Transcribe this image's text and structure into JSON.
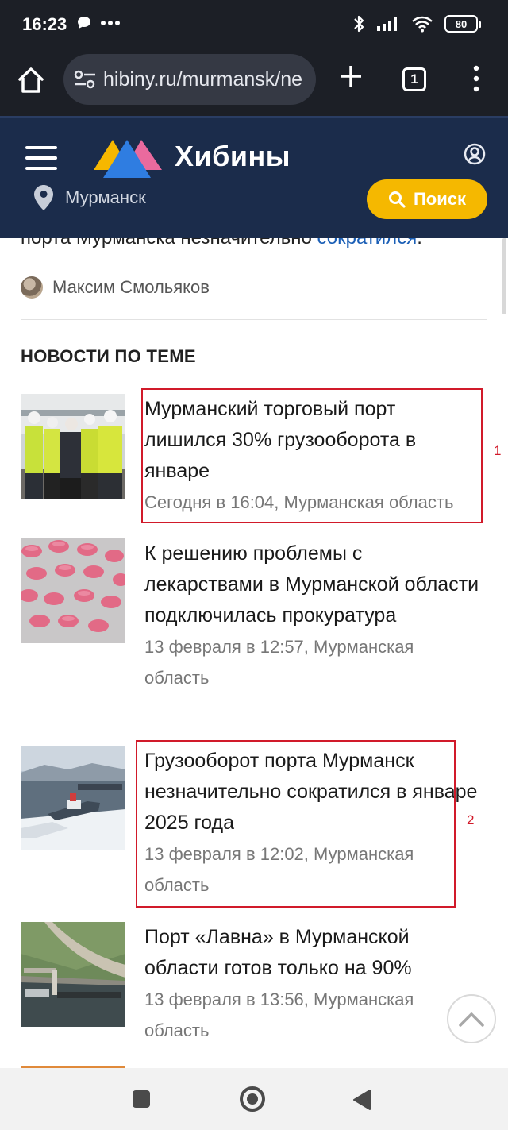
{
  "status_bar": {
    "time": "16:23",
    "battery": "80",
    "icons": [
      "chat-bubble-icon",
      "more-dots-icon",
      "bluetooth-icon",
      "signal-icon",
      "wifi-icon",
      "battery-icon"
    ]
  },
  "browser": {
    "url": "hibiny.ru/murmansk/ne",
    "tab_count": "1"
  },
  "site": {
    "logo_text": "Хибины",
    "city": "Мурманск",
    "search_label": "Поиск",
    "brand_colors": {
      "header_bg": "#1b2c4b",
      "search_btn": "#f5b800",
      "logo_yellow": "#f6b700",
      "logo_blue": "#2f7de1",
      "logo_pink": "#ea6a9e"
    }
  },
  "article": {
    "cut_text_prefix": "порта Мурманска незначительно ",
    "cut_text_link": "сократился",
    "cut_text_suffix": ".",
    "author": "Максим Смольяков"
  },
  "related": {
    "title": "НОВОСТИ ПО ТЕМЕ",
    "items": [
      {
        "title": "Мурманский торговый порт лишился 30% грузооборота в январе",
        "meta": "Сегодня в 16:04, Мурманская область",
        "image": "workers-in-hi-vis-vests"
      },
      {
        "title": "К решению проблемы с лекарствами в Мурманской области подключилась прокуратура",
        "meta": "13 февраля в 12:57, Мурманская область",
        "image": "pink-pills-blister"
      },
      {
        "title": "Грузооборот порта Мурманск незначительно сократился в январе 2025 года",
        "meta": "13 февраля в 12:02, Мурманская область",
        "image": "icebreaker-in-port"
      },
      {
        "title": "Порт «Лавна» в Мурманской области готов только на 90%",
        "meta": "13 февраля в 13:56, Мурманская область",
        "image": "port-aerial-view"
      }
    ]
  },
  "annotations": {
    "box1_label": "1",
    "box2_label": "2",
    "color": "#d11a2a"
  }
}
